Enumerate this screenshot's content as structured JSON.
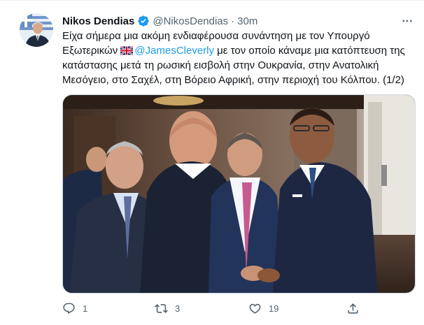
{
  "author": {
    "name": "Nikos Dendias",
    "handle": "@NikosDendias",
    "separator": "·",
    "time": "30m"
  },
  "tweet": {
    "line1": "Είχα σήμερα μια ακόμη ενδιαφέρουσα συνάντηση με τον Υπουργό",
    "line2_prefix": "Εξωτερικών ",
    "mention": "@JamesCleverly",
    "line2_suffix": " με τον οποίο κάναμε μια κατόπτευση της",
    "line3": "κατάστασης μετά τη ρωσική εισβολή στην Ουκρανία, στην Ανατολική",
    "line4": "Μεσόγειο, στο Σαχέλ, στη Βόρειο Αφρική, στην περιοχή του Κόλπου. (1/2)"
  },
  "actions": {
    "reply_count": "1",
    "retweet_count": "3",
    "like_count": "19"
  },
  "icons": {
    "verified": "verified-badge-icon",
    "more": "more-options-icon",
    "reply": "reply-icon",
    "retweet": "retweet-icon",
    "like": "heart-icon",
    "share": "share-icon",
    "flag": "uk-flag-icon"
  },
  "colors": {
    "accent": "#1d9bf0",
    "secondary_text": "#536471",
    "primary_text": "#0f1419"
  }
}
